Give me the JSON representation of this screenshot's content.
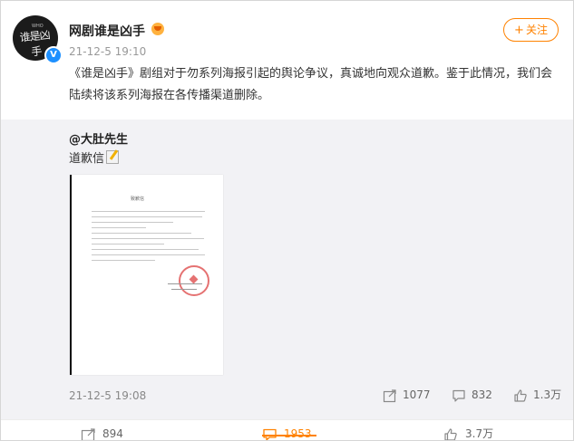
{
  "post": {
    "username": "网剧谁是凶手",
    "avatar_text": "谁是凶手",
    "timestamp": "21-12-5 19:10",
    "follow_label": "关注",
    "text": "《谁是凶手》剧组对于勿系列海报引起的舆论争议，真诚地向观众道歉。鉴于此情况，我们会陆续将该系列海报在各传播渠道删除。"
  },
  "repost": {
    "original_user": "@大肚先生",
    "original_text": "道歉信",
    "letter_title": "致歉信",
    "timestamp": "21-12-5 19:08",
    "shares": "1077",
    "comments": "832",
    "likes": "1.3万"
  },
  "actions": {
    "shares": "894",
    "comments": "1953",
    "likes": "3.7万"
  },
  "colors": {
    "accent": "#ff8200",
    "verified": "#1e90ff",
    "repost_bg": "#f2f2f5"
  },
  "icons": {
    "verified": "v-badge-icon",
    "share": "share-icon",
    "comment": "comment-icon",
    "like": "thumbs-up-icon"
  }
}
